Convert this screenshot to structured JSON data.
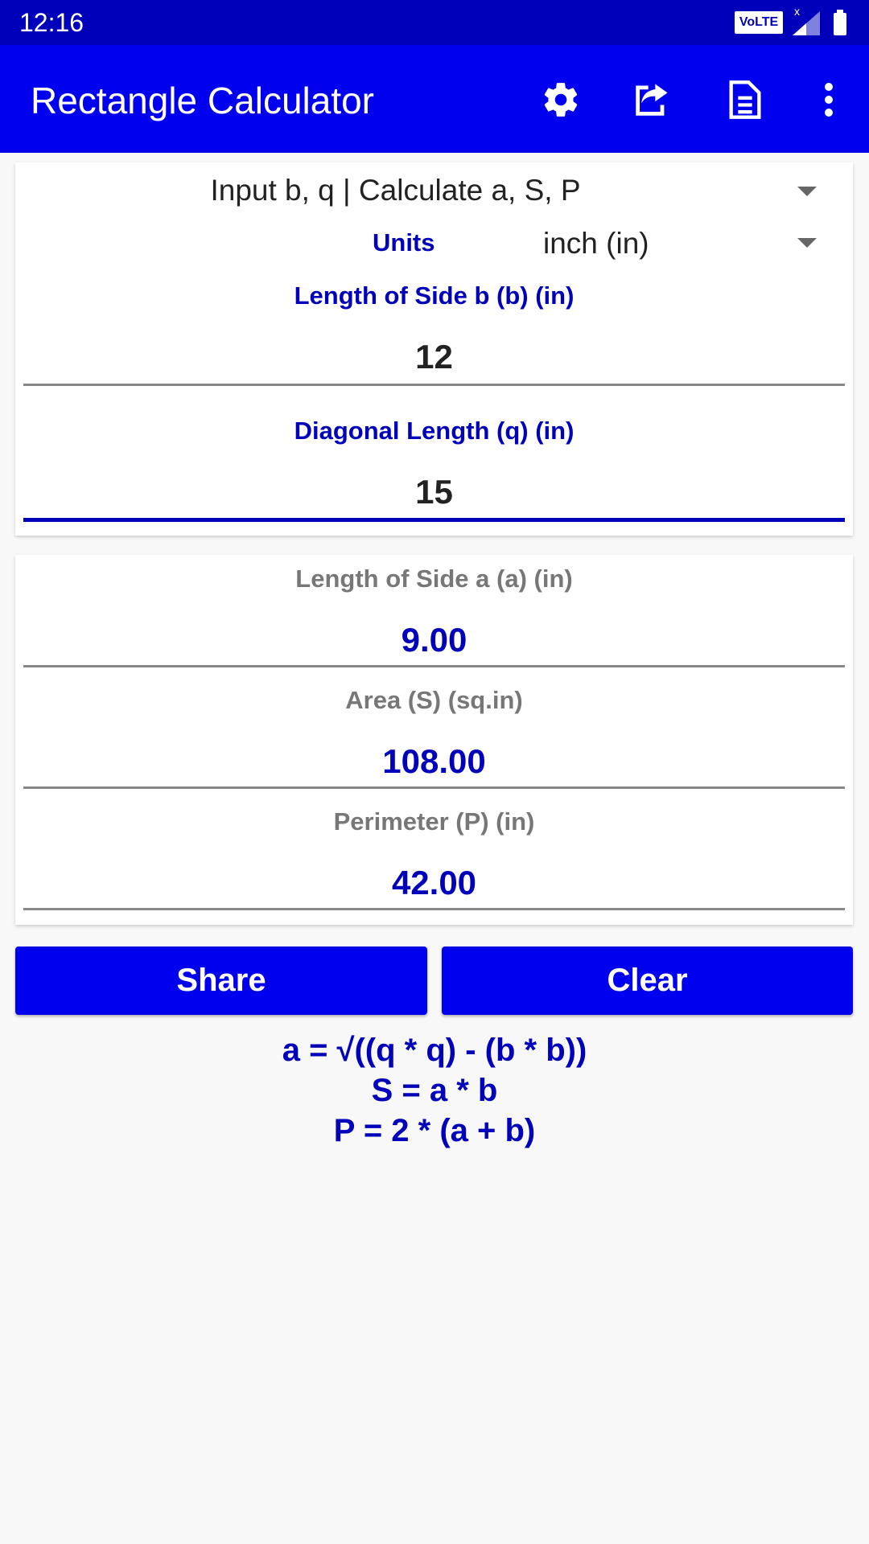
{
  "status_bar": {
    "time": "12:16",
    "network_badge": "VoLTE"
  },
  "app_bar": {
    "title": "Rectangle Calculator",
    "actions": [
      {
        "name": "settings",
        "icon": "gear-icon"
      },
      {
        "name": "share",
        "icon": "share-icon"
      },
      {
        "name": "document",
        "icon": "document-icon"
      },
      {
        "name": "more",
        "icon": "more-vert-icon"
      }
    ]
  },
  "input_card": {
    "mode_select": "Input b, q | Calculate a, S, P",
    "units_label": "Units",
    "units_select": "inch (in)",
    "fields": [
      {
        "label": "Length of Side b (b) (in)",
        "value": "12"
      },
      {
        "label": "Diagonal Length (q) (in)",
        "value": "15"
      }
    ]
  },
  "results_card": {
    "results": [
      {
        "label": "Length of Side a (a) (in)",
        "value": "9.00"
      },
      {
        "label": "Area (S) (sq.in)",
        "value": "108.00"
      },
      {
        "label": "Perimeter (P) (in)",
        "value": "42.00"
      }
    ]
  },
  "buttons": {
    "share": "Share",
    "clear": "Clear"
  },
  "formulas": [
    "a = √((q * q) - (b * b))",
    "S = a * b",
    "P = 2 * (a + b)"
  ],
  "colors": {
    "primary": "#0000ee",
    "primary_dark": "#0000bb",
    "accent_text": "#0000bb"
  }
}
